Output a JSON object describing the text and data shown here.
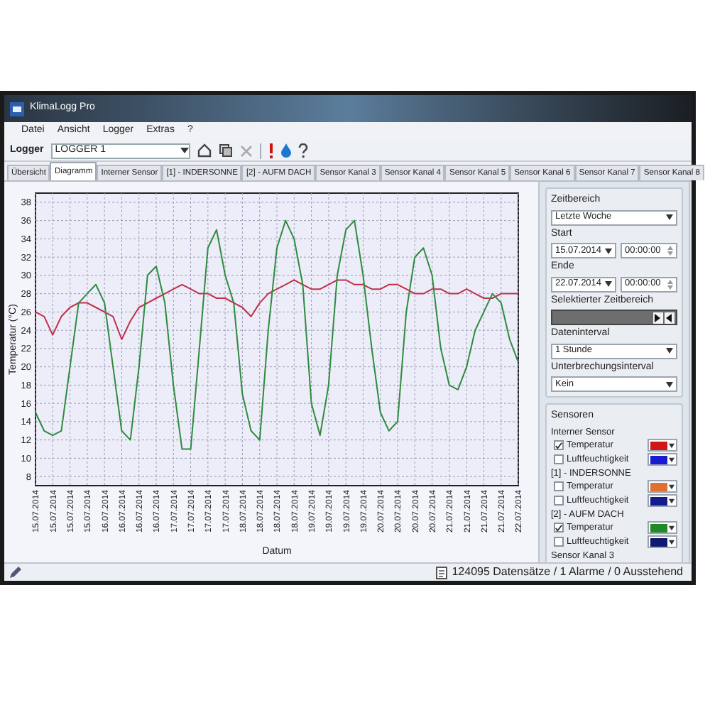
{
  "window": {
    "title": "KlimaLogg Pro"
  },
  "menu": [
    "Datei",
    "Ansicht",
    "Logger",
    "Extras",
    "?"
  ],
  "toolbar": {
    "logger_label": "Logger",
    "logger_value": "LOGGER 1"
  },
  "tabs": [
    {
      "label": "Übersicht",
      "selected": false
    },
    {
      "label": "Diagramm",
      "selected": true
    },
    {
      "label": "Interner Sensor",
      "selected": false
    },
    {
      "label": "[1] - INDERSONNE",
      "selected": false
    },
    {
      "label": "[2] - AUFM DACH",
      "selected": false
    },
    {
      "label": "Sensor Kanal 3",
      "selected": false
    },
    {
      "label": "Sensor Kanal 4",
      "selected": false
    },
    {
      "label": "Sensor Kanal 5",
      "selected": false
    },
    {
      "label": "Sensor Kanal 6",
      "selected": false
    },
    {
      "label": "Sensor Kanal 7",
      "selected": false
    },
    {
      "label": "Sensor Kanal 8",
      "selected": false
    }
  ],
  "chart": {
    "chart_data": {
      "type": "line",
      "xlabel": "Datum",
      "ylabel": "Temperatur (°C)",
      "categories": [
        "15.07.2014",
        null,
        "15.07.2014",
        null,
        "15.07.2014",
        null,
        "15.07.2014",
        null,
        "16.07.2014",
        null,
        "16.07.2014",
        null,
        "16.07.2014",
        null,
        "16.07.2014",
        null,
        "17.07.2014",
        null,
        "17.07.2014",
        null,
        "17.07.2014",
        null,
        "17.07.2014",
        null,
        "18.07.2014",
        null,
        "18.07.2014",
        null,
        "18.07.2014",
        null,
        "18.07.2014",
        null,
        "19.07.2014",
        null,
        "19.07.2014",
        null,
        "19.07.2014",
        null,
        "19.07.2014",
        null,
        "20.07.2014",
        null,
        "20.07.2014",
        null,
        "20.07.2014",
        null,
        "20.07.2014",
        null,
        "21.07.2014",
        null,
        "21.07.2014",
        null,
        "21.07.2014",
        null,
        "21.07.2014",
        null,
        "22.07.2014"
      ],
      "series": [
        {
          "color": "#c0304a",
          "values": [
            26,
            25.5,
            23.5,
            25.5,
            26.5,
            27,
            27,
            26.5,
            26,
            25.5,
            23,
            25,
            26.5,
            27,
            27.5,
            28,
            28.5,
            29,
            28.5,
            28,
            28,
            27.5,
            27.5,
            27,
            26.5,
            25.5,
            27,
            28,
            28.5,
            29,
            29.5,
            29,
            28.5,
            28.5,
            29,
            29.5,
            29.5,
            29,
            29,
            28.5,
            28.5,
            29,
            29,
            28.5,
            28,
            28,
            28.5,
            28.5,
            28,
            28,
            28.5,
            28,
            27.5,
            27.5,
            28,
            28,
            28
          ]
        },
        {
          "color": "#2e8b3e",
          "values": [
            15,
            13,
            12.5,
            13,
            20,
            27,
            28,
            29,
            27,
            20,
            13,
            12,
            20,
            30,
            31,
            27,
            18,
            11,
            11,
            22,
            33,
            35,
            30,
            27,
            17,
            13,
            12,
            24,
            33,
            36,
            34,
            29,
            16,
            12.5,
            18,
            30,
            35,
            36,
            30,
            22,
            15,
            13,
            14,
            26,
            32,
            33,
            30,
            22,
            18,
            17.5,
            20,
            24,
            26,
            28,
            27,
            23,
            20.5
          ]
        }
      ],
      "ylim": [
        7,
        39
      ],
      "grid": true,
      "yticks": [
        8,
        10,
        12,
        14,
        16,
        18,
        20,
        22,
        24,
        26,
        28,
        30,
        32,
        34,
        36,
        38
      ]
    }
  },
  "side_panel": {
    "time_range": {
      "title": "Zeitbereich",
      "preset": "Letzte Woche",
      "start_label": "Start",
      "start_date": "15.07.2014",
      "start_time": "00:00:00",
      "end_label": "Ende",
      "end_date": "22.07.2014",
      "end_time": "00:00:00",
      "selection_label": "Selektierter Zeitbereich",
      "data_interval_label": "Dateninterval",
      "data_interval": "1 Stunde",
      "gap_label": "Unterbrechungsinterval",
      "gap": "Kein"
    },
    "sensors": {
      "title": "Sensoren",
      "groups": [
        {
          "name": "Interner Sensor",
          "channels": [
            {
              "label": "Temperatur",
              "checked": true,
              "color": "#d01818"
            },
            {
              "label": "Luftfeuchtigkeit",
              "checked": false,
              "color": "#1a1ad0"
            }
          ]
        },
        {
          "name": "[1] - INDERSONNE",
          "channels": [
            {
              "label": "Temperatur",
              "checked": false,
              "color": "#e07030"
            },
            {
              "label": "Luftfeuchtigkeit",
              "checked": false,
              "color": "#141a90"
            }
          ]
        },
        {
          "name": "[2] - AUFM DACH",
          "channels": [
            {
              "label": "Temperatur",
              "checked": true,
              "color": "#208a28"
            },
            {
              "label": "Luftfeuchtigkeit",
              "checked": false,
              "color": "#101870"
            }
          ]
        },
        {
          "name": "Sensor Kanal 3"
        }
      ]
    }
  },
  "status_bar": {
    "records": "124095 Datensätze / 1 Alarme / 0 Ausstehend"
  }
}
